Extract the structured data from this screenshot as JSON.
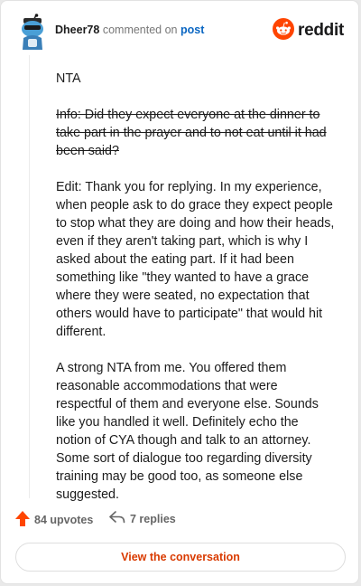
{
  "header": {
    "username": "Dheer78",
    "action_text": "commented on",
    "post_link": "post",
    "brand_name": "reddit",
    "brand_color": "#ff4500"
  },
  "comment": {
    "paragraph_1": "NTA",
    "paragraph_2_struck": "Info: Did they expect everyone at the dinner to take part in the prayer and to not eat until it had been said?",
    "paragraph_3": "Edit: Thank you for replying. In my experience, when people ask to do grace they expect people to stop what they are doing and how their heads, even if they aren't taking part, which is why I asked about the eating part. If it had been something like \"they wanted to have a grace where they were seated, no expectation that others would have to participate\" that would hit different.",
    "paragraph_4": "A strong NTA from me. You offered them reasonable accommodations that were respectful of them and everyone else. Sounds like you handled it well. Definitely echo the notion of CYA though and talk to an attorney. Some sort of dialogue too regarding diversity training may be good too, as someone else suggested."
  },
  "footer": {
    "upvotes_label": "84 upvotes",
    "replies_label": "7 replies",
    "upvote_color": "#ff4500",
    "view_button_label": "View the conversation",
    "view_button_color": "#d93a00"
  },
  "icons": [
    "avatar",
    "reddit-logo-icon",
    "upvote-arrow-icon",
    "reply-arrow-icon"
  ]
}
